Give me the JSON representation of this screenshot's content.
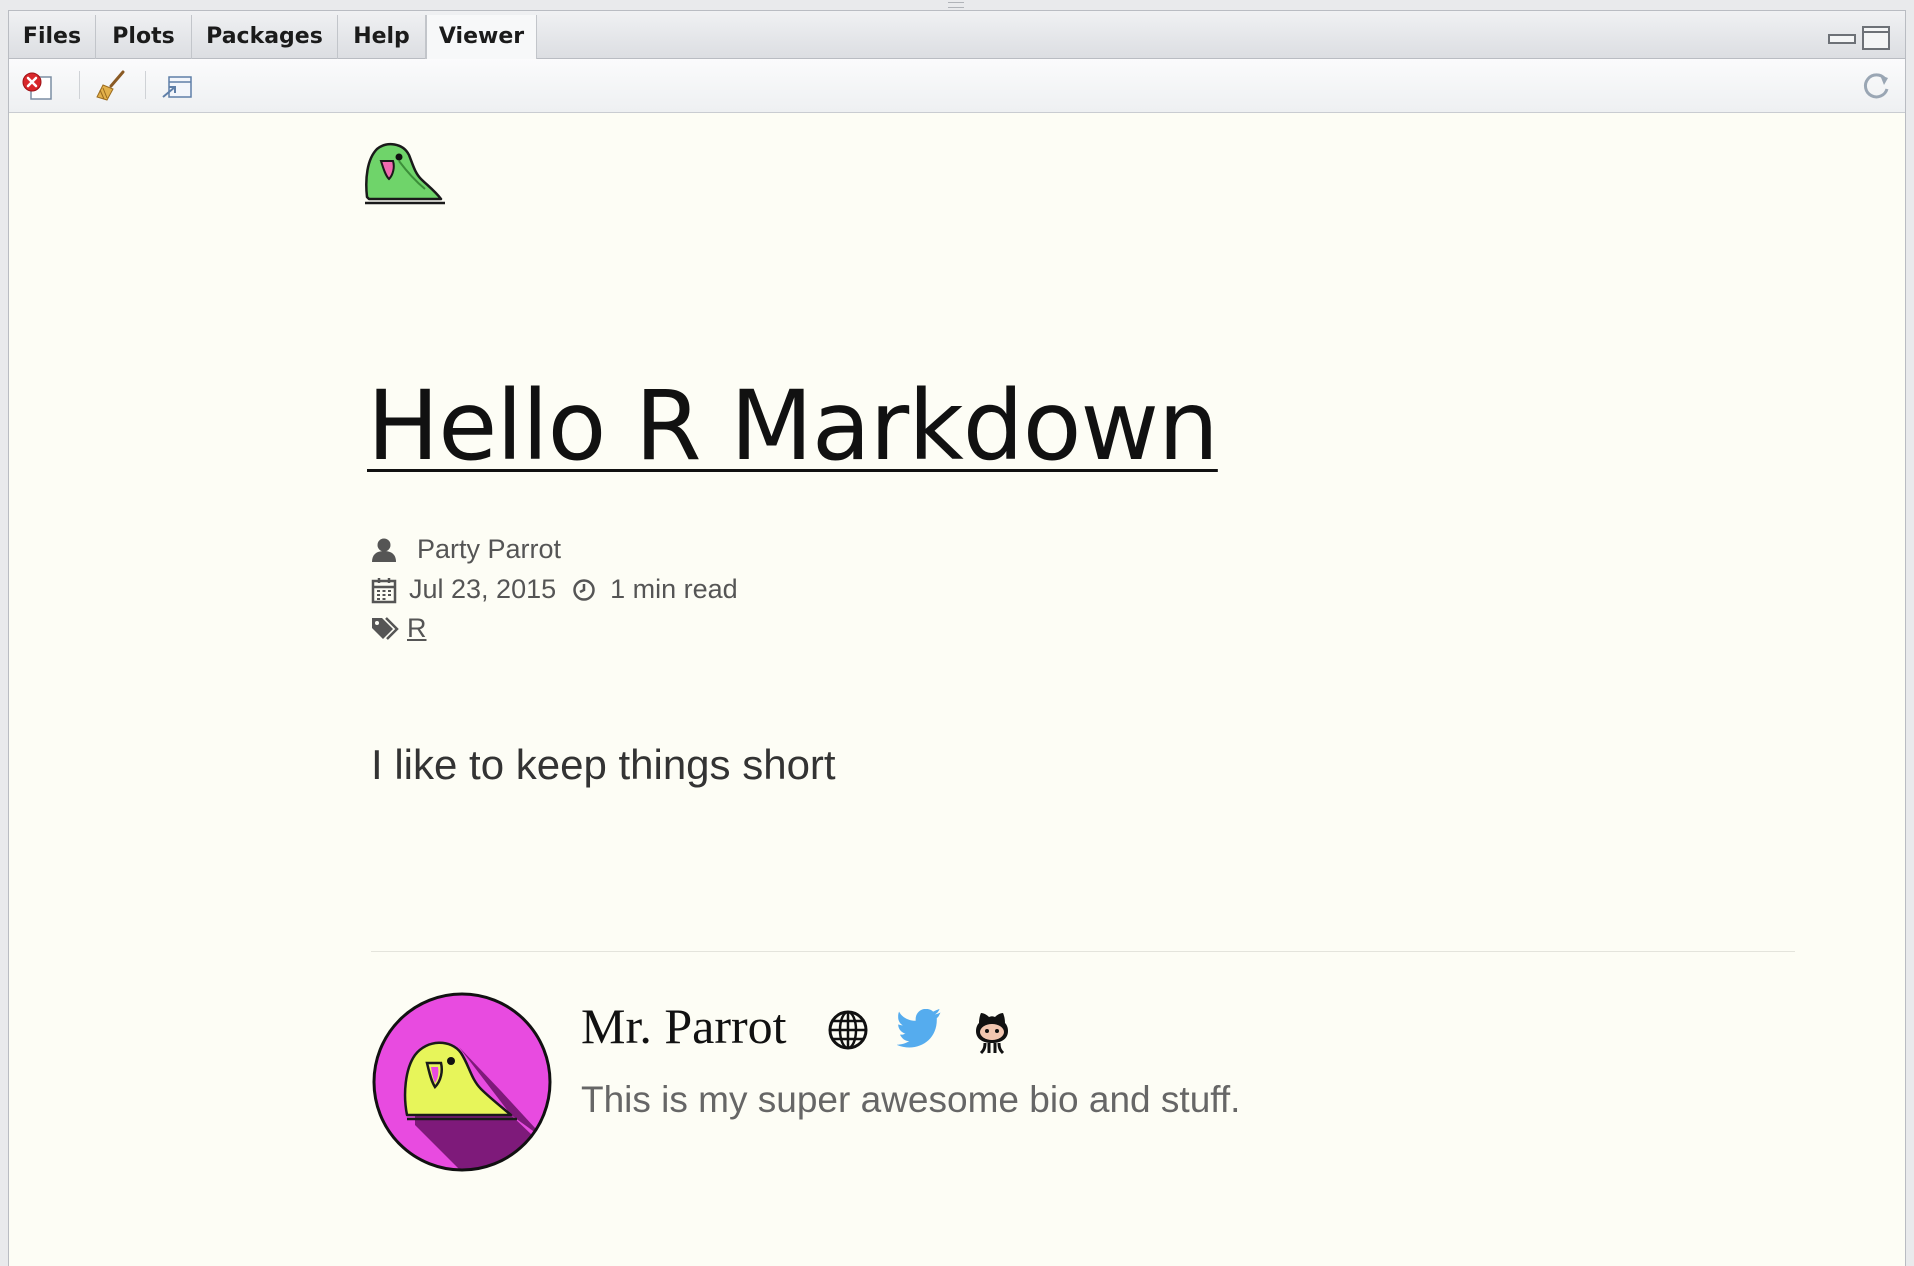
{
  "tabs": [
    {
      "label": "Files",
      "active": false
    },
    {
      "label": "Plots",
      "active": false
    },
    {
      "label": "Packages",
      "active": false
    },
    {
      "label": "Help",
      "active": false
    },
    {
      "label": "Viewer",
      "active": true
    }
  ],
  "toolbar": {
    "buttons": [
      {
        "icon": "remove-viewer-icon"
      },
      {
        "icon": "clear-all-icon"
      },
      {
        "icon": "show-in-window-icon"
      }
    ],
    "refresh_icon": "refresh-icon"
  },
  "window_controls": [
    "minimize-icon",
    "maximize-icon"
  ],
  "post": {
    "title": "Hello R Markdown",
    "author": "Party Parrot",
    "date": "Jul 23, 2015",
    "reading_time": "1 min read",
    "tag": "R",
    "body": "I like to keep things short"
  },
  "author_box": {
    "name": "Mr. Parrot",
    "bio": "This is my super awesome bio and stuff.",
    "links": [
      "globe-icon",
      "twitter-icon",
      "github-icon"
    ]
  },
  "colors": {
    "page_background": "#fdfdf5",
    "parrot_green": "#6fd46a",
    "avatar_magenta": "#e84be0",
    "avatar_shadow": "#7e1a7a",
    "parrot_yellow": "#e7f55a",
    "twitter_blue": "#55acee"
  }
}
